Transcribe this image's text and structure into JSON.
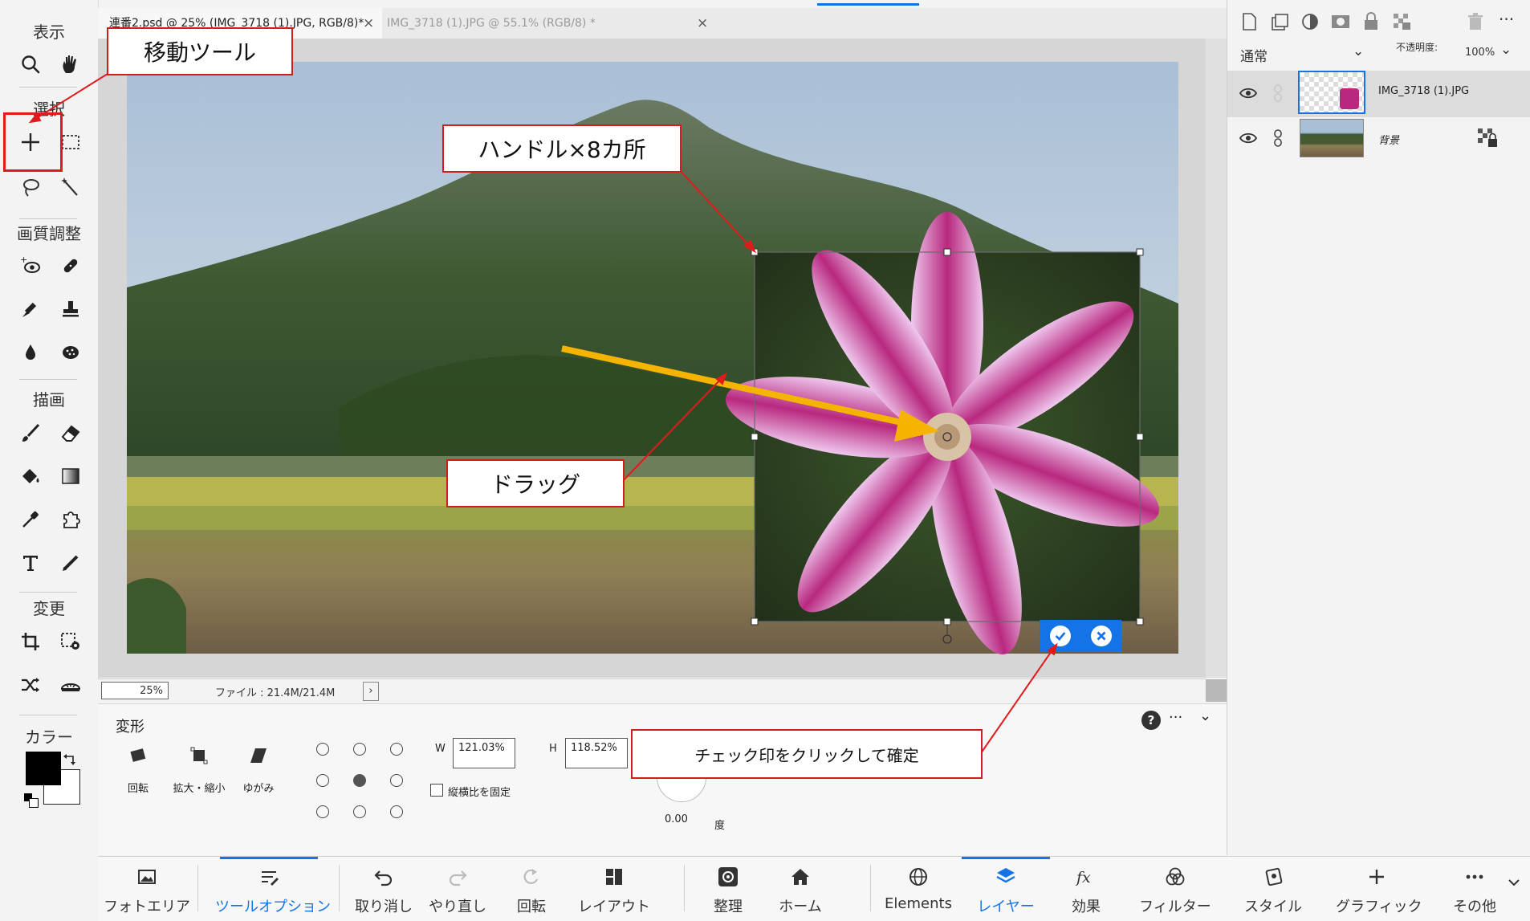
{
  "toolbar": {
    "sections": {
      "view": "表示",
      "select": "選択",
      "enhance": "画質調整",
      "draw": "描画",
      "modify": "変更",
      "color": "カラー"
    }
  },
  "document": {
    "tabs": [
      {
        "label": "連番2.psd @ 25% (IMG_3718 (1).JPG, RGB/8)*",
        "close": "×",
        "active": true
      },
      {
        "label": "IMG_3718 (1).JPG @ 55.1% (RGB/8) *",
        "close": "×",
        "active": false
      }
    ],
    "status": {
      "zoom": "25%",
      "file": "ファイル : 21.4M/21.4M",
      "arrow": "›"
    }
  },
  "options": {
    "title": "変形",
    "modes": [
      {
        "label": "回転"
      },
      {
        "label": "拡大・縮小"
      },
      {
        "label": "ゆがみ"
      }
    ],
    "width": {
      "label": "W",
      "value": "121.03%"
    },
    "height": {
      "label": "H",
      "value": "118.52%"
    },
    "constrain": "縦横比を固定",
    "angle": {
      "value": "0.00",
      "unit": "度"
    },
    "help": "?",
    "more": "···",
    "collapse": "⌄"
  },
  "layers": {
    "blend_mode": "通常",
    "opacity_label": "不透明度:",
    "opacity_value": "100%",
    "rows": [
      {
        "name": "IMG_3718 (1).JPG",
        "selected": true
      },
      {
        "name": "背景",
        "selected": false
      }
    ]
  },
  "taskbar": {
    "items": [
      {
        "label": "フォトエリア",
        "icon": "photo-bin-icon"
      },
      {
        "label": "ツールオプション",
        "icon": "tool-options-icon",
        "active": true
      },
      {
        "label": "取り消し",
        "icon": "undo-icon"
      },
      {
        "label": "やり直し",
        "icon": "redo-icon"
      },
      {
        "label": "回転",
        "icon": "rotate-icon"
      },
      {
        "label": "レイアウト",
        "icon": "layout-icon"
      },
      {
        "label": "整理",
        "icon": "organizer-icon"
      },
      {
        "label": "ホーム",
        "icon": "home-icon"
      },
      {
        "label": "Elements",
        "icon": "globe-icon"
      },
      {
        "label": "レイヤー",
        "icon": "layers-icon",
        "active": true
      },
      {
        "label": "効果",
        "icon": "fx-icon"
      },
      {
        "label": "フィルター",
        "icon": "filter-icon"
      },
      {
        "label": "スタイル",
        "icon": "styles-icon"
      },
      {
        "label": "グラフィック",
        "icon": "graphics-icon"
      },
      {
        "label": "その他",
        "icon": "more-icon"
      }
    ]
  },
  "annotations": {
    "move_tool": "移動ツール",
    "handles": "ハンドル×8カ所",
    "drag": "ドラッグ",
    "confirm": "チェック印をクリックして確定"
  },
  "colors": {
    "accent": "#1473e6",
    "annotation_red": "#d21d1d",
    "drag_arrow": "#f5b400"
  }
}
